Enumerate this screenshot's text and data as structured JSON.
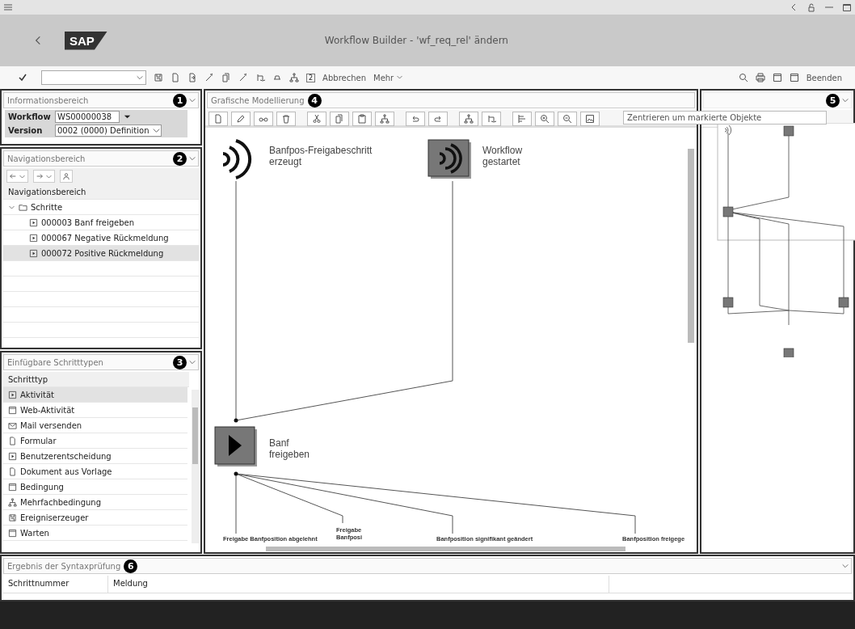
{
  "header": {
    "logo": "SAP",
    "title": "Workflow Builder - 'wf_req_rel' ändern"
  },
  "toolbar": {
    "number_key": "2",
    "buttons": [
      "Abbrechen",
      "Mehr"
    ],
    "exit": "Beenden"
  },
  "info_panel": {
    "title": "Informationsbereich",
    "callout": "1",
    "fields": [
      {
        "label": "Workflow",
        "value": "WS00000038",
        "kind": "dropdown"
      },
      {
        "label": "Version",
        "value": "0002 (0000) Definition",
        "kind": "select"
      }
    ]
  },
  "nav_panel": {
    "title": "Navigationsbereich",
    "callout": "2",
    "header": "Navigationsbereich",
    "tree": [
      {
        "label": "Schritte",
        "expanded": true,
        "selected": false,
        "children": [
          {
            "label": "000003 Banf freigeben",
            "selected": false
          },
          {
            "label": "000067 Negative Rückmeldung",
            "selected": false
          },
          {
            "label": "000072 Positive Rückmeldung",
            "selected": true
          }
        ]
      }
    ]
  },
  "step_types": {
    "title": "Einfügbare Schritttypen",
    "callout": "3",
    "column": "Schritttyp",
    "items": [
      {
        "label": "Aktivität",
        "kind": "activity",
        "selected": true
      },
      {
        "label": "Web-Aktivität",
        "kind": "web",
        "selected": false
      },
      {
        "label": "Mail versenden",
        "kind": "mail",
        "selected": false
      },
      {
        "label": "Formular",
        "kind": "form",
        "selected": false
      },
      {
        "label": "Benutzerentscheidung",
        "kind": "decision",
        "selected": false
      },
      {
        "label": "Dokument aus Vorlage",
        "kind": "document",
        "selected": false
      },
      {
        "label": "Bedingung",
        "kind": "condition",
        "selected": false
      },
      {
        "label": "Mehrfachbedingung",
        "kind": "multi",
        "selected": false
      },
      {
        "label": "Ereigniserzeuger",
        "kind": "event",
        "selected": false
      },
      {
        "label": "Warten",
        "kind": "wait",
        "selected": false
      }
    ]
  },
  "modeler": {
    "title": "Grafische Modellierung",
    "callout": "4",
    "center_button": "Zentrieren um markierte Objekte",
    "nodes": [
      {
        "kind": "event",
        "label": [
          "Banfpos-Freigabeschritt",
          "erzeugt"
        ]
      },
      {
        "kind": "event_box",
        "label": [
          "Workflow",
          "gestartet"
        ]
      },
      {
        "kind": "activity",
        "label": [
          "Banf",
          "freigeben"
        ]
      }
    ],
    "outcomes": [
      {
        "label": [
          "Freigabe Banfposition abgelehnt"
        ]
      },
      {
        "label": [
          "Freigabe",
          "Banfposi"
        ]
      },
      {
        "label": [
          "Banfposition signifikant geändert"
        ]
      },
      {
        "label": [
          "Banfposition freigege"
        ]
      }
    ]
  },
  "overview": {
    "callout": "5"
  },
  "syntax": {
    "title": "Ergebnis der Syntaxprüfung",
    "callout": "6",
    "columns": [
      "Schrittnummer",
      "Meldung"
    ]
  }
}
